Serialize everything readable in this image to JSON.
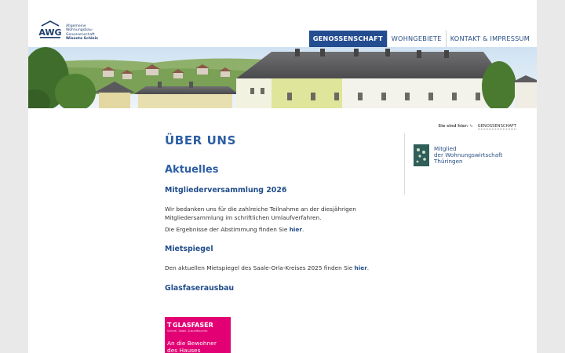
{
  "logo": {
    "abbr": "AWG",
    "lines": [
      "Allgemeine",
      "Wohnungsbau-",
      "Genossenschaft",
      "Wisenta Schleiz"
    ]
  },
  "nav": {
    "items": [
      {
        "label": "GENOSSENSCHAFT",
        "active": true
      },
      {
        "label": "WOHNGEBIETE",
        "active": false
      },
      {
        "label": "KONTAKT & IMPRESSUM",
        "active": false
      }
    ]
  },
  "breadcrumb": {
    "label": "Sie sind hier:",
    "current": "GENOSSENSCHAFT"
  },
  "main": {
    "title": "ÜBER UNS",
    "section_title": "Aktuelles",
    "news": [
      {
        "heading": "Mitgliederversammlung 2026",
        "para1": "Wir bedanken uns für die zahlreiche Teilnahme an der diesjährigen Mitgliedersammlung im schriftlichen Umlaufverfahren.",
        "para2_prefix": "Die Ergebnisse der Abstimmung finden Sie ",
        "para2_link": "hier",
        "para2_suffix": "."
      },
      {
        "heading": "Mietspiegel",
        "para_prefix": "Den aktuellen Mietspiegel des Saale-Orla-Kreises 2025 finden Sie ",
        "para_link": "hier",
        "para_suffix": "."
      },
      {
        "heading": "Glasfaserausbau"
      }
    ]
  },
  "sidebar": {
    "badge_lines": [
      "Mitglied",
      "der Wohnungswirtschaft",
      "Thüringen"
    ]
  },
  "glasfaser": {
    "brand": "GLASFASER",
    "tagline": "Schnell. Stabil. Zukunftssicher.",
    "line1": "An die Bewohner",
    "line2": "des Hauses"
  },
  "colors": {
    "primary": "#234c91",
    "heading": "#2d5ea4",
    "magenta": "#e20074"
  }
}
